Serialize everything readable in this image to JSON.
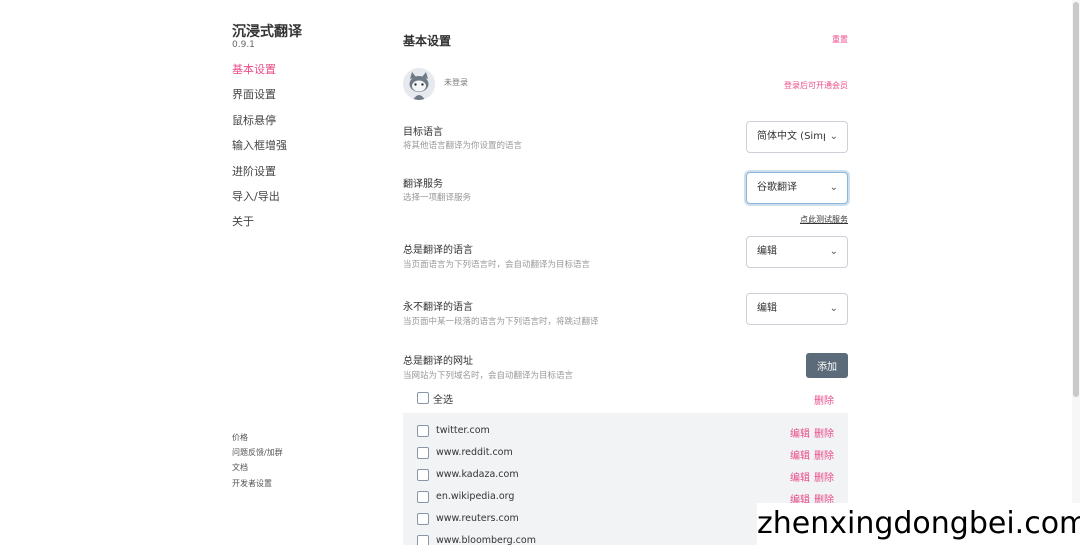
{
  "app": {
    "title": "沉浸式翻译",
    "version": "0.9.1"
  },
  "sidebar": {
    "items": [
      {
        "label": "基本设置",
        "active": true
      },
      {
        "label": "界面设置"
      },
      {
        "label": "鼠标悬停"
      },
      {
        "label": "输入框增强"
      },
      {
        "label": "进阶设置"
      },
      {
        "label": "导入/导出"
      },
      {
        "label": "关于"
      }
    ],
    "footer": [
      "价格",
      "问题反馈/加群",
      "文档",
      "开发者设置"
    ]
  },
  "main": {
    "title": "基本设置",
    "reset_label": "重置",
    "account": {
      "status": "未登录",
      "vip_link": "登录后可开通会员"
    },
    "target_language": {
      "label": "目标语言",
      "desc": "将其他语言翻译为你设置的语言",
      "value": "简体中文 (Simpl"
    },
    "translation_service": {
      "label": "翻译服务",
      "desc": "选择一项翻译服务",
      "value": "谷歌翻译",
      "test_link": "点此测试服务"
    },
    "always_translate_languages": {
      "label": "总是翻译的语言",
      "desc": "当页面语言为下列语言时，会自动翻译为目标语言",
      "value": "编辑"
    },
    "never_translate_languages": {
      "label": "永不翻译的语言",
      "desc": "当页面中某一段落的语言为下列语言时，将跳过翻译",
      "value": "编辑"
    },
    "always_translate_urls": {
      "label": "总是翻译的网址",
      "desc": "当网站为下列域名时，会自动翻译为目标语言",
      "add_label": "添加",
      "select_all_label": "全选",
      "delete_all_label": "删除",
      "edit_label": "编辑",
      "delete_label": "删除",
      "urls": [
        "twitter.com",
        "www.reddit.com",
        "www.kadaza.com",
        "en.wikipedia.org",
        "www.reuters.com",
        "www.bloomberg.com"
      ]
    }
  },
  "watermark": "zhenxingdongbei.com",
  "colors": {
    "accent": "#ea4c89",
    "button": "#5c6b7a",
    "list_bg": "#f1f3f5"
  }
}
